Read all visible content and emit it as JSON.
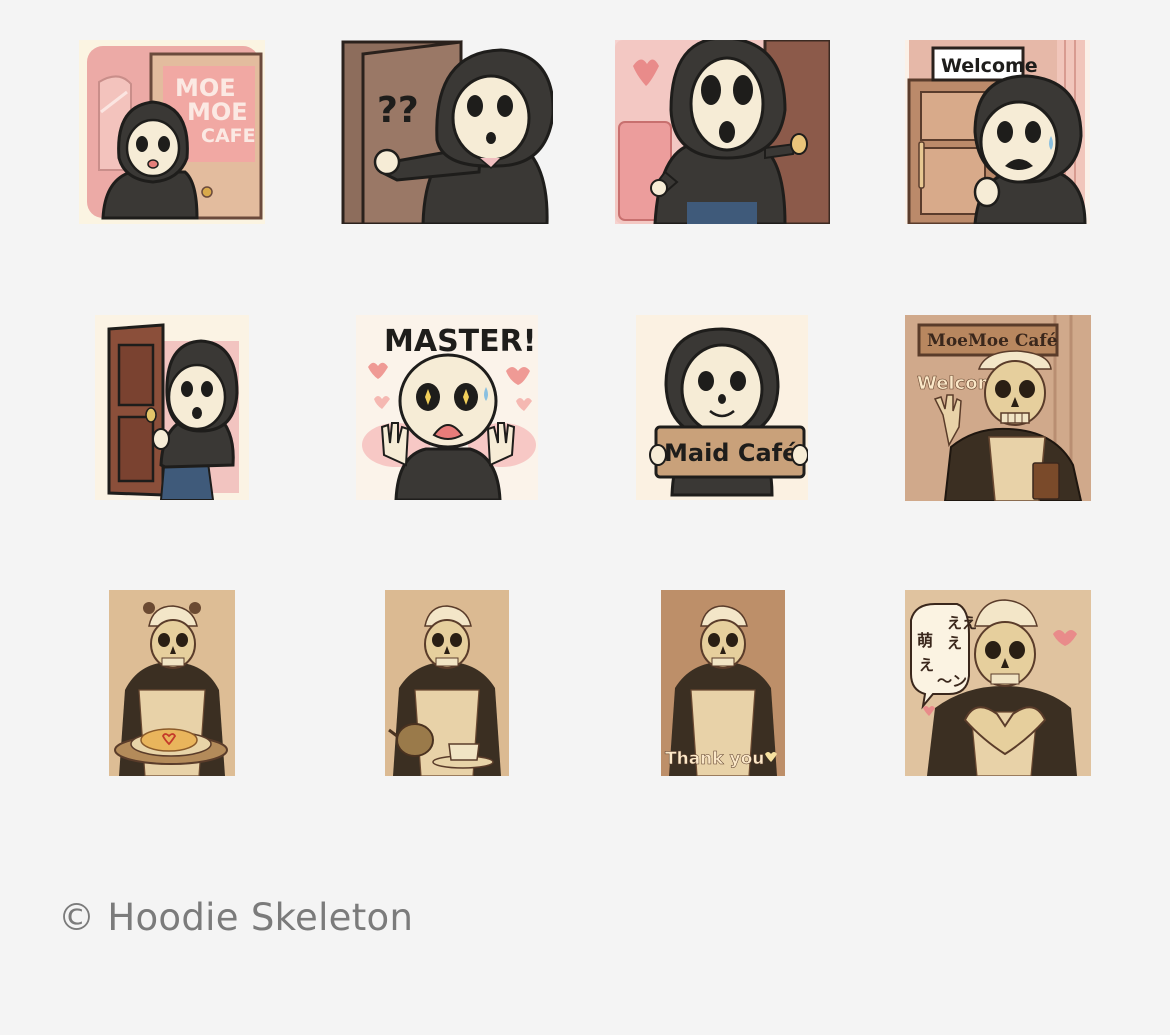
{
  "stickers": [
    {
      "id": 1,
      "name": "moe-moe-cafe-peek",
      "sign_text": [
        "MOE",
        "MOE",
        "CAFE"
      ]
    },
    {
      "id": 2,
      "name": "confused-door-knock",
      "text": "??"
    },
    {
      "id": 3,
      "name": "shocked-at-door"
    },
    {
      "id": 4,
      "name": "welcome-sign-nervous",
      "sign_text": "Welcome"
    },
    {
      "id": 5,
      "name": "peeking-behind-door"
    },
    {
      "id": 6,
      "name": "master-shout",
      "text": "MASTER!"
    },
    {
      "id": 7,
      "name": "maid-cafe-signboard",
      "sign_text": "Maid Café"
    },
    {
      "id": 8,
      "name": "skeleton-maid-welcome",
      "sign_text": "MoeMoe Café",
      "caption": "Welcome"
    },
    {
      "id": 9,
      "name": "skeleton-maid-omurice"
    },
    {
      "id": 10,
      "name": "skeleton-maid-tea"
    },
    {
      "id": 11,
      "name": "skeleton-maid-thank-you",
      "caption": "Thank you"
    },
    {
      "id": 12,
      "name": "skeleton-maid-heart-hands",
      "bubble_text": "萌ええええ〜ン"
    }
  ],
  "footer": {
    "copyright": "© Hoodie Skeleton"
  },
  "colors": {
    "background": "#f4f4f4",
    "hoodie": "#3a3835",
    "skull_cartoon": "#f6ecd6",
    "sepia": "#c9a878",
    "pink": "#efb7b0"
  }
}
